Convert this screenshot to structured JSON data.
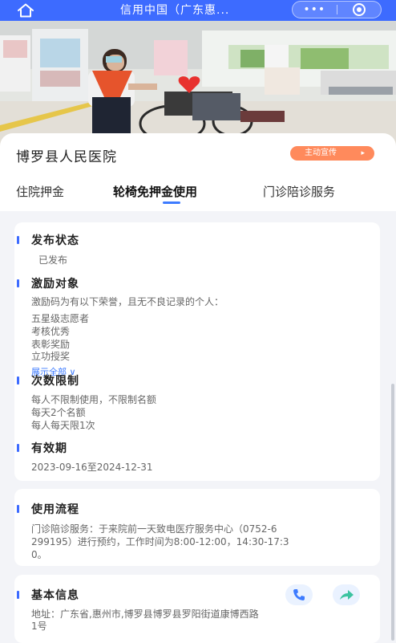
{
  "navbar": {
    "title": "信用中国（广东惠...",
    "more_label": "•••"
  },
  "hospital": {
    "name": "博罗县人民医院",
    "consult_label": "主动宣传"
  },
  "tabs": [
    {
      "label": "住院押金"
    },
    {
      "label": "轮椅免押金使用"
    },
    {
      "label": "门诊陪诊服务"
    }
  ],
  "sections": {
    "publish": {
      "title": "发布状态",
      "value": "已发布"
    },
    "incentive": {
      "title": "激励对象",
      "desc": "激励码为有以下荣誉，且无不良记录的个人：",
      "items": [
        "五星级志愿者",
        "考核优秀",
        "表彰奖励",
        "立功授奖"
      ],
      "expand_label": "展示全部 ∨"
    },
    "limit": {
      "title": "次数限制",
      "items": [
        "每人不限制使用，不限制名额",
        "每天2个名额",
        "每人每天限1次"
      ]
    },
    "validity": {
      "title": "有效期",
      "value": "2023-09-16至2024-12-31"
    },
    "process": {
      "title": "使用流程",
      "lines": [
        "门诊陪诊服务：于来院前一天致电医疗服务中心（0752-6",
        "299195）进行预约，工作时间为8:00-12:00，14:30-17:3",
        "0。"
      ]
    },
    "basic": {
      "title": "基本信息",
      "address_lines": [
        "地址：广东省,惠州市,博罗县博罗县罗阳街道康博西路",
        "1号"
      ]
    }
  },
  "colors": {
    "primary": "#3d6bff",
    "accent_orange": "#ff8a5c",
    "link_blue": "#3d7bff"
  }
}
